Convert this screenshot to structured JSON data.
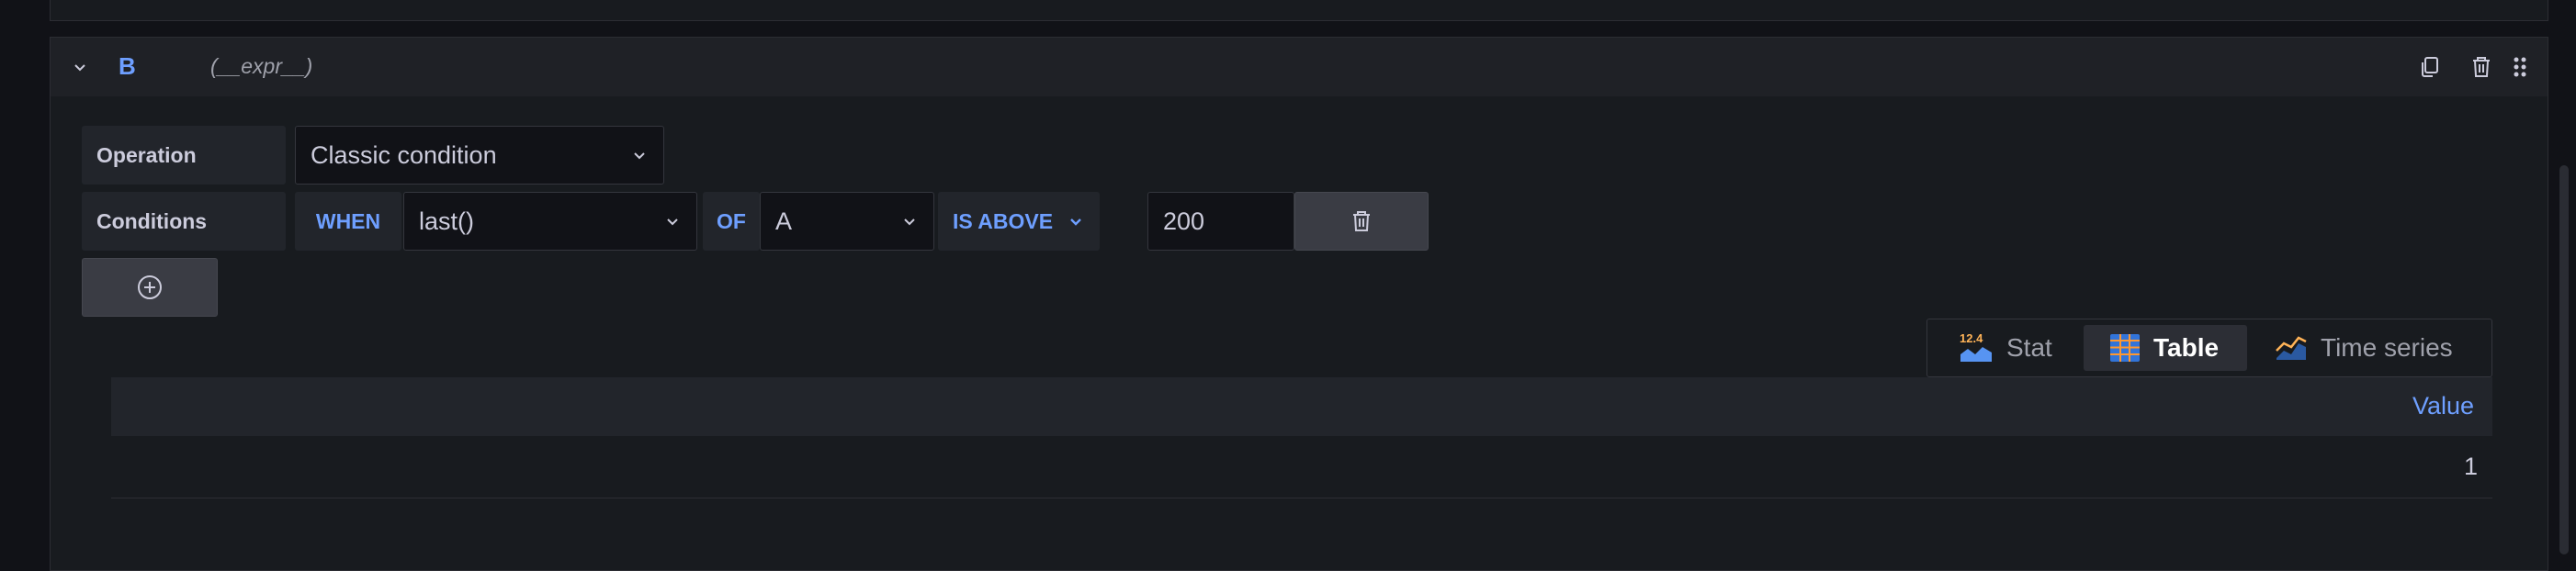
{
  "query": {
    "ref_id": "B",
    "expression_label": "(__expr__)",
    "operation": {
      "label": "Operation",
      "value": "Classic condition"
    },
    "conditions": {
      "label": "Conditions",
      "when": "WHEN",
      "reducer": "last()",
      "of": "OF",
      "query": "A",
      "evaluator": "IS ABOVE",
      "threshold": "200"
    }
  },
  "viz_toggle": {
    "options": [
      {
        "label": "Stat",
        "icon_text": "12.4"
      },
      {
        "label": "Table"
      },
      {
        "label": "Time series"
      }
    ],
    "selected": "Table"
  },
  "table": {
    "column": "Value",
    "rows": [
      [
        "1"
      ]
    ]
  },
  "colors": {
    "accent": "#6e9fff",
    "background": "#111217",
    "panel": "#181b1f"
  }
}
